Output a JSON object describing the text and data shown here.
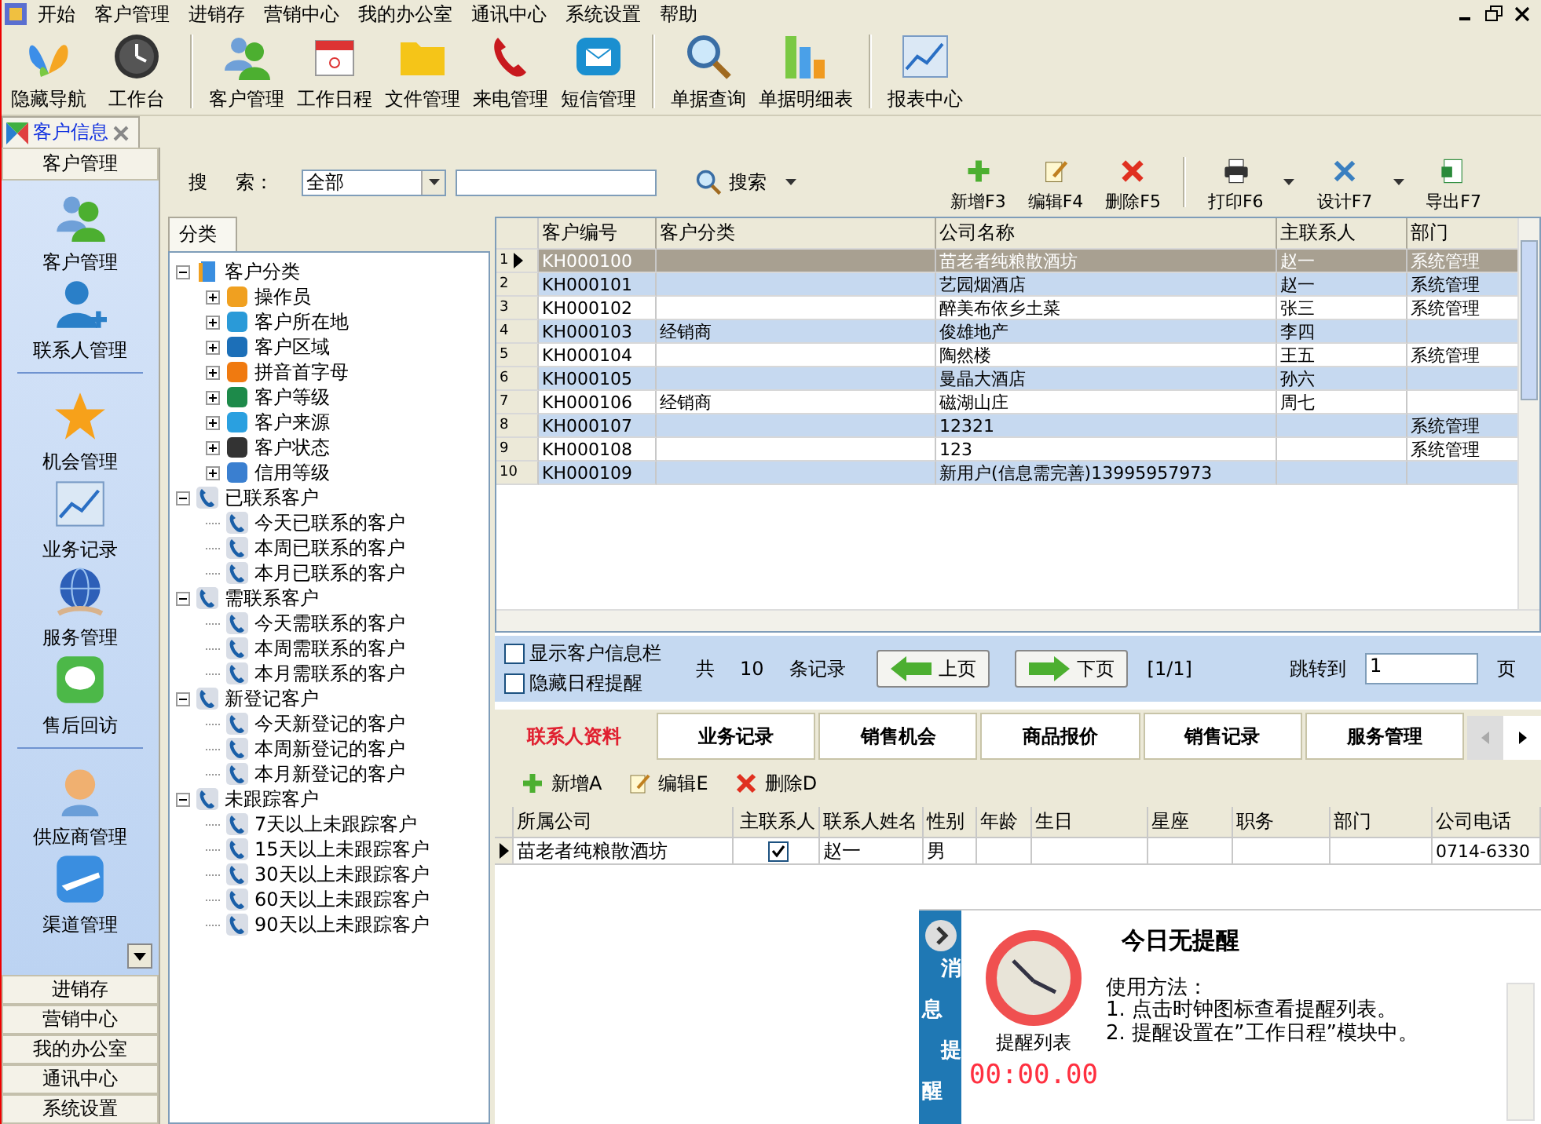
{
  "menu": [
    "开始",
    "客户管理",
    "进销存",
    "营销中心",
    "我的办公室",
    "通讯中心",
    "系统设置",
    "帮助"
  ],
  "toolbar": [
    [
      {
        "label": "隐藏导航",
        "kind": "butterfly"
      },
      {
        "label": "工作台",
        "kind": "clock"
      }
    ],
    [
      {
        "label": "客户管理",
        "kind": "people"
      },
      {
        "label": "工作日程",
        "kind": "calendar"
      },
      {
        "label": "文件管理",
        "kind": "folder"
      },
      {
        "label": "来电管理",
        "kind": "phone"
      },
      {
        "label": "短信管理",
        "kind": "mail"
      }
    ],
    [
      {
        "label": "单据查询",
        "kind": "search"
      },
      {
        "label": "单据明细表",
        "kind": "bars"
      }
    ],
    [
      {
        "label": "报表中心",
        "kind": "chart"
      }
    ]
  ],
  "doc_tabs": [
    {
      "label": "客户信息",
      "selected": true
    }
  ],
  "nav": {
    "title": "客户管理",
    "groups": [
      [
        {
          "label": "客户管理",
          "kind": "people"
        },
        {
          "label": "联系人管理",
          "kind": "person-add"
        }
      ],
      [
        {
          "label": "机会管理",
          "kind": "star"
        },
        {
          "label": "业务记录",
          "kind": "chart"
        },
        {
          "label": "服务管理",
          "kind": "globe"
        },
        {
          "label": "售后回访",
          "kind": "chat"
        }
      ],
      [
        {
          "label": "供应商管理",
          "kind": "person"
        },
        {
          "label": "渠道管理",
          "kind": "plane"
        }
      ]
    ],
    "sections": [
      "进销存",
      "营销中心",
      "我的办公室",
      "通讯中心",
      "系统设置"
    ]
  },
  "search": {
    "label_1": "搜",
    "label_2": "索：",
    "scope": "全部",
    "button": "搜索"
  },
  "actions": [
    [
      {
        "label": "新增F3",
        "kind": "add",
        "menu": false
      },
      {
        "label": "编辑F4",
        "kind": "edit",
        "menu": false
      },
      {
        "label": "删除F5",
        "kind": "delete",
        "menu": false
      }
    ],
    [
      {
        "label": "打印F6",
        "kind": "print",
        "menu": true
      },
      {
        "label": "设计F7",
        "kind": "tools",
        "menu": true
      },
      {
        "label": "导出F7",
        "kind": "excel",
        "menu": false
      }
    ]
  ],
  "tree": {
    "tab": "分类",
    "nodes": [
      {
        "label": "客户分类",
        "kind": "book",
        "expanded": true,
        "children": [
          {
            "label": "操作员",
            "kind": "category",
            "expanded": false
          },
          {
            "label": "客户所在地",
            "kind": "category",
            "expanded": false
          },
          {
            "label": "客户区域",
            "kind": "category",
            "expanded": false
          },
          {
            "label": "拼音首字母",
            "kind": "category",
            "expanded": false
          },
          {
            "label": "客户等级",
            "kind": "category",
            "expanded": false
          },
          {
            "label": "客户来源",
            "kind": "category",
            "expanded": false
          },
          {
            "label": "客户状态",
            "kind": "category",
            "expanded": false
          },
          {
            "label": "信用等级",
            "kind": "category",
            "expanded": false
          }
        ]
      },
      {
        "label": "已联系客户",
        "kind": "call",
        "expanded": true,
        "children": [
          {
            "label": "今天已联系的客户",
            "kind": "call"
          },
          {
            "label": "本周已联系的客户",
            "kind": "call"
          },
          {
            "label": "本月已联系的客户",
            "kind": "call"
          }
        ]
      },
      {
        "label": "需联系客户",
        "kind": "call",
        "expanded": true,
        "children": [
          {
            "label": "今天需联系的客户",
            "kind": "call"
          },
          {
            "label": "本周需联系的客户",
            "kind": "call"
          },
          {
            "label": "本月需联系的客户",
            "kind": "call"
          }
        ]
      },
      {
        "label": "新登记客户",
        "kind": "call",
        "expanded": true,
        "children": [
          {
            "label": "今天新登记的客户",
            "kind": "call"
          },
          {
            "label": "本周新登记的客户",
            "kind": "call"
          },
          {
            "label": "本月新登记的客户",
            "kind": "call"
          }
        ]
      },
      {
        "label": "未跟踪客户",
        "kind": "call",
        "expanded": true,
        "children": [
          {
            "label": "7天以上未跟踪客户",
            "kind": "call"
          },
          {
            "label": "15天以上未跟踪客户",
            "kind": "call"
          },
          {
            "label": "30天以上未跟踪客户",
            "kind": "call"
          },
          {
            "label": "60天以上未跟踪客户",
            "kind": "call"
          },
          {
            "label": "90天以上未跟踪客户",
            "kind": "call"
          }
        ]
      }
    ]
  },
  "grid": {
    "columns": [
      "客户编号",
      "客户分类",
      "公司名称",
      "主联系人",
      "部门"
    ],
    "rows": [
      {
        "number": "1",
        "selected": true,
        "id": "KH000100",
        "company": "苗老者纯粮散酒坊",
        "contact": "赵一",
        "department": "系统管理"
      },
      {
        "number": "2",
        "selected": false,
        "id": "KH000101",
        "company": "艺园烟酒店",
        "contact": "赵一",
        "department": "系统管理"
      },
      {
        "number": "3",
        "selected": false,
        "id": "KH000102",
        "company": "醉美布依乡土菜",
        "contact": "张三",
        "department": "系统管理"
      },
      {
        "number": "4",
        "selected": false,
        "id": "KH000103",
        "category": "经销商",
        "company": "俊雄地产",
        "contact": "李四"
      },
      {
        "number": "5",
        "selected": false,
        "id": "KH000104",
        "company": "陶然楼",
        "contact": "王五",
        "department": "系统管理"
      },
      {
        "number": "6",
        "selected": false,
        "id": "KH000105",
        "company": "曼晶大酒店",
        "contact": "孙六"
      },
      {
        "number": "7",
        "selected": false,
        "id": "KH000106",
        "category": "经销商",
        "company": "磁湖山庄",
        "contact": "周七"
      },
      {
        "number": "8",
        "selected": false,
        "id": "KH000107",
        "company": "12321",
        "department": "系统管理"
      },
      {
        "number": "9",
        "selected": false,
        "id": "KH000108",
        "company": "123",
        "department": "系统管理"
      },
      {
        "number": "10",
        "selected": false,
        "id": "KH000109",
        "company": "新用户(信息需完善)13995957973"
      }
    ]
  },
  "pager": {
    "options": [
      {
        "label": "显示客户信息栏",
        "checked": false
      },
      {
        "label": "隐藏日程提醒",
        "checked": false
      }
    ],
    "total_prefix": "共",
    "total": "10",
    "total_suffix": "条记录",
    "prev": "上页",
    "next": "下页",
    "page": "[1/1]",
    "jump_label": "跳转到",
    "jump_value": "1",
    "jump_suffix": "页"
  },
  "detail_tabs": [
    {
      "label": "联系人资料",
      "selected": true
    },
    {
      "label": "业务记录",
      "selected": false
    },
    {
      "label": "销售机会",
      "selected": false
    },
    {
      "label": "商品报价",
      "selected": false
    },
    {
      "label": "销售记录",
      "selected": false
    },
    {
      "label": "服务管理",
      "selected": false
    }
  ],
  "detail_actions": [
    {
      "label": "新增A",
      "kind": "add"
    },
    {
      "label": "编辑E",
      "kind": "edit"
    },
    {
      "label": "删除D",
      "kind": "delete"
    }
  ],
  "contacts": {
    "columns": [
      "所属公司",
      "主联系人",
      "联系人姓名",
      "性别",
      "年龄",
      "生日",
      "星座",
      "职务",
      "部门",
      "公司电话"
    ],
    "rows": [
      {
        "current": true,
        "company": "苗老者纯粮散酒坊",
        "primary": true,
        "name": "赵一",
        "gender": "男",
        "phone": "0714-6330"
      }
    ]
  },
  "reminder": {
    "side_title": "消息提醒",
    "clock_label": "提醒列表",
    "timer": "00:00.00",
    "title": "今日无提醒",
    "lines": [
      "使用方法：",
      "1. 点击时钟图标查看提醒列表。",
      "2. 提醒设置在”工作日程”模块中。"
    ]
  }
}
